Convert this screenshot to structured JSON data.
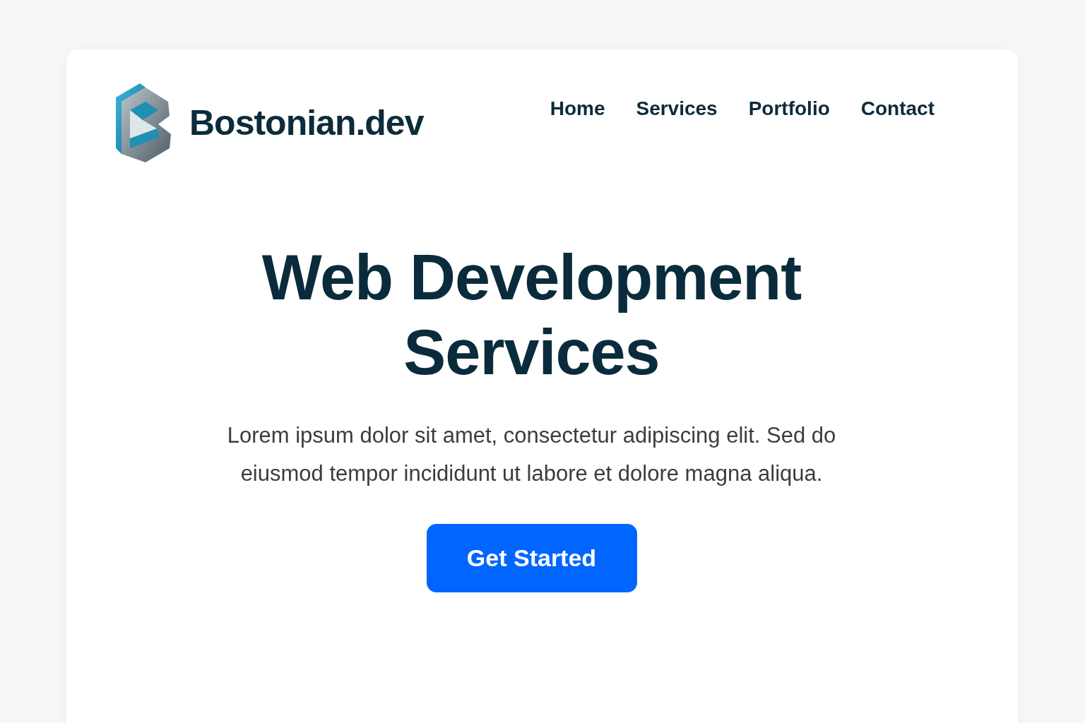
{
  "brand": {
    "name": "Bostonian.dev"
  },
  "nav": [
    {
      "label": "Home"
    },
    {
      "label": "Services"
    },
    {
      "label": "Portfolio"
    },
    {
      "label": "Contact"
    }
  ],
  "hero": {
    "title": "Web Development Services",
    "text": "Lorem ipsum dolor sit amet, consectetur adipiscing elit. Sed do eiusmod tempor incididunt ut labore et dolore magna aliqua.",
    "button": "Get Started"
  }
}
